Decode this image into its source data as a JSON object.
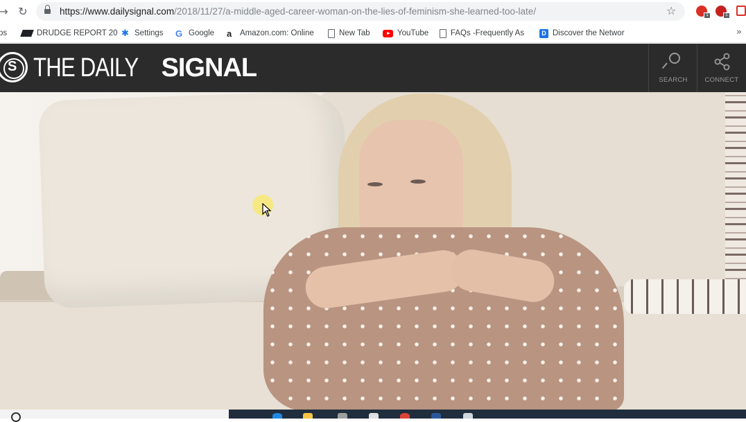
{
  "browser": {
    "url_host": "https://www.dailysignal.com",
    "url_path": "/2018/11/27/a-middle-aged-career-woman-on-the-lies-of-feminism-she-learned-too-late/",
    "ext_badge_1": "1",
    "ext_badge_2": "1"
  },
  "bookmarks": {
    "items": [
      {
        "label": "ps",
        "icon": "apps-icon"
      },
      {
        "label": "DRUDGE REPORT 20",
        "icon": "drudge-icon"
      },
      {
        "label": "Settings",
        "icon": "gear-icon"
      },
      {
        "label": "Google",
        "icon": "google-icon"
      },
      {
        "label": "Amazon.com: Online",
        "icon": "amazon-icon"
      },
      {
        "label": "New Tab",
        "icon": "page-icon"
      },
      {
        "label": "YouTube",
        "icon": "youtube-icon"
      },
      {
        "label": "FAQs -Frequently As",
        "icon": "page-icon"
      },
      {
        "label": "Discover the Networ",
        "icon": "discover-icon"
      }
    ],
    "more": "»"
  },
  "site": {
    "logo_thin": "THE DAILY",
    "logo_bold": "SIGNAL",
    "logo_mark": "S",
    "search_label": "SEARCH",
    "connect_label": "CONNECT"
  },
  "colors": {
    "header_bg": "#2b2b2b",
    "accent_red": "#d93025",
    "taskbar": "#1f2d3d"
  }
}
